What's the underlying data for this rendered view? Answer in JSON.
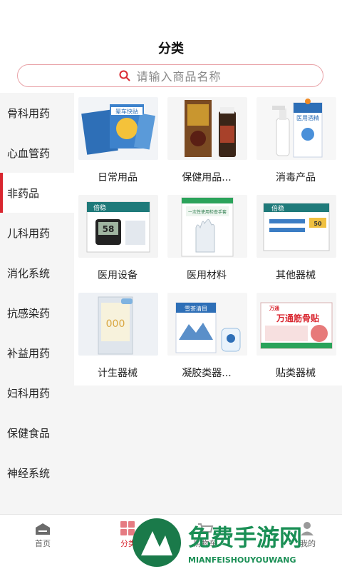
{
  "header": {
    "title": "分类"
  },
  "search": {
    "placeholder": "请输入商品名称",
    "icon": "search-icon"
  },
  "sidebar": {
    "active_index": 2,
    "items": [
      "骨科用药",
      "心血管药",
      "非药品",
      "儿科用药",
      "消化系统",
      "抗感染药",
      "补益用药",
      "妇科用药",
      "保健食品",
      "神经系统"
    ]
  },
  "categories": [
    {
      "label": "日常用品"
    },
    {
      "label": "保健用品..."
    },
    {
      "label": "消毒产品"
    },
    {
      "label": "医用设备"
    },
    {
      "label": "医用材料"
    },
    {
      "label": "其他器械"
    },
    {
      "label": "计生器械"
    },
    {
      "label": "凝胶类器..."
    },
    {
      "label": "贴类器械"
    }
  ],
  "product_text": {
    "patch": "晕车快贴",
    "spray": "医用酒精",
    "meter_brand": "倍稳",
    "meter_reading": "58",
    "gloves": "一次性使用检查手套",
    "strips_qty": "50",
    "gel": "雪茶清目",
    "plaster_brand": "万通",
    "plaster": "万通筋骨贴"
  },
  "tabbar": {
    "active_index": 1,
    "items": [
      {
        "label": "首页",
        "icon": "home-icon"
      },
      {
        "label": "分类",
        "icon": "category-icon"
      },
      {
        "label": "购物车",
        "icon": "cart-icon"
      },
      {
        "label": "",
        "icon": "message-icon"
      },
      {
        "label": "我的",
        "icon": "user-icon"
      }
    ]
  },
  "watermark": {
    "title": "免费手游网",
    "subtitle": "MIANFEISHOUYOUWANG"
  },
  "colors": {
    "accent": "#d9262f",
    "sidebar_bg": "#f5f5f5",
    "search_border": "#e9a3a8"
  }
}
